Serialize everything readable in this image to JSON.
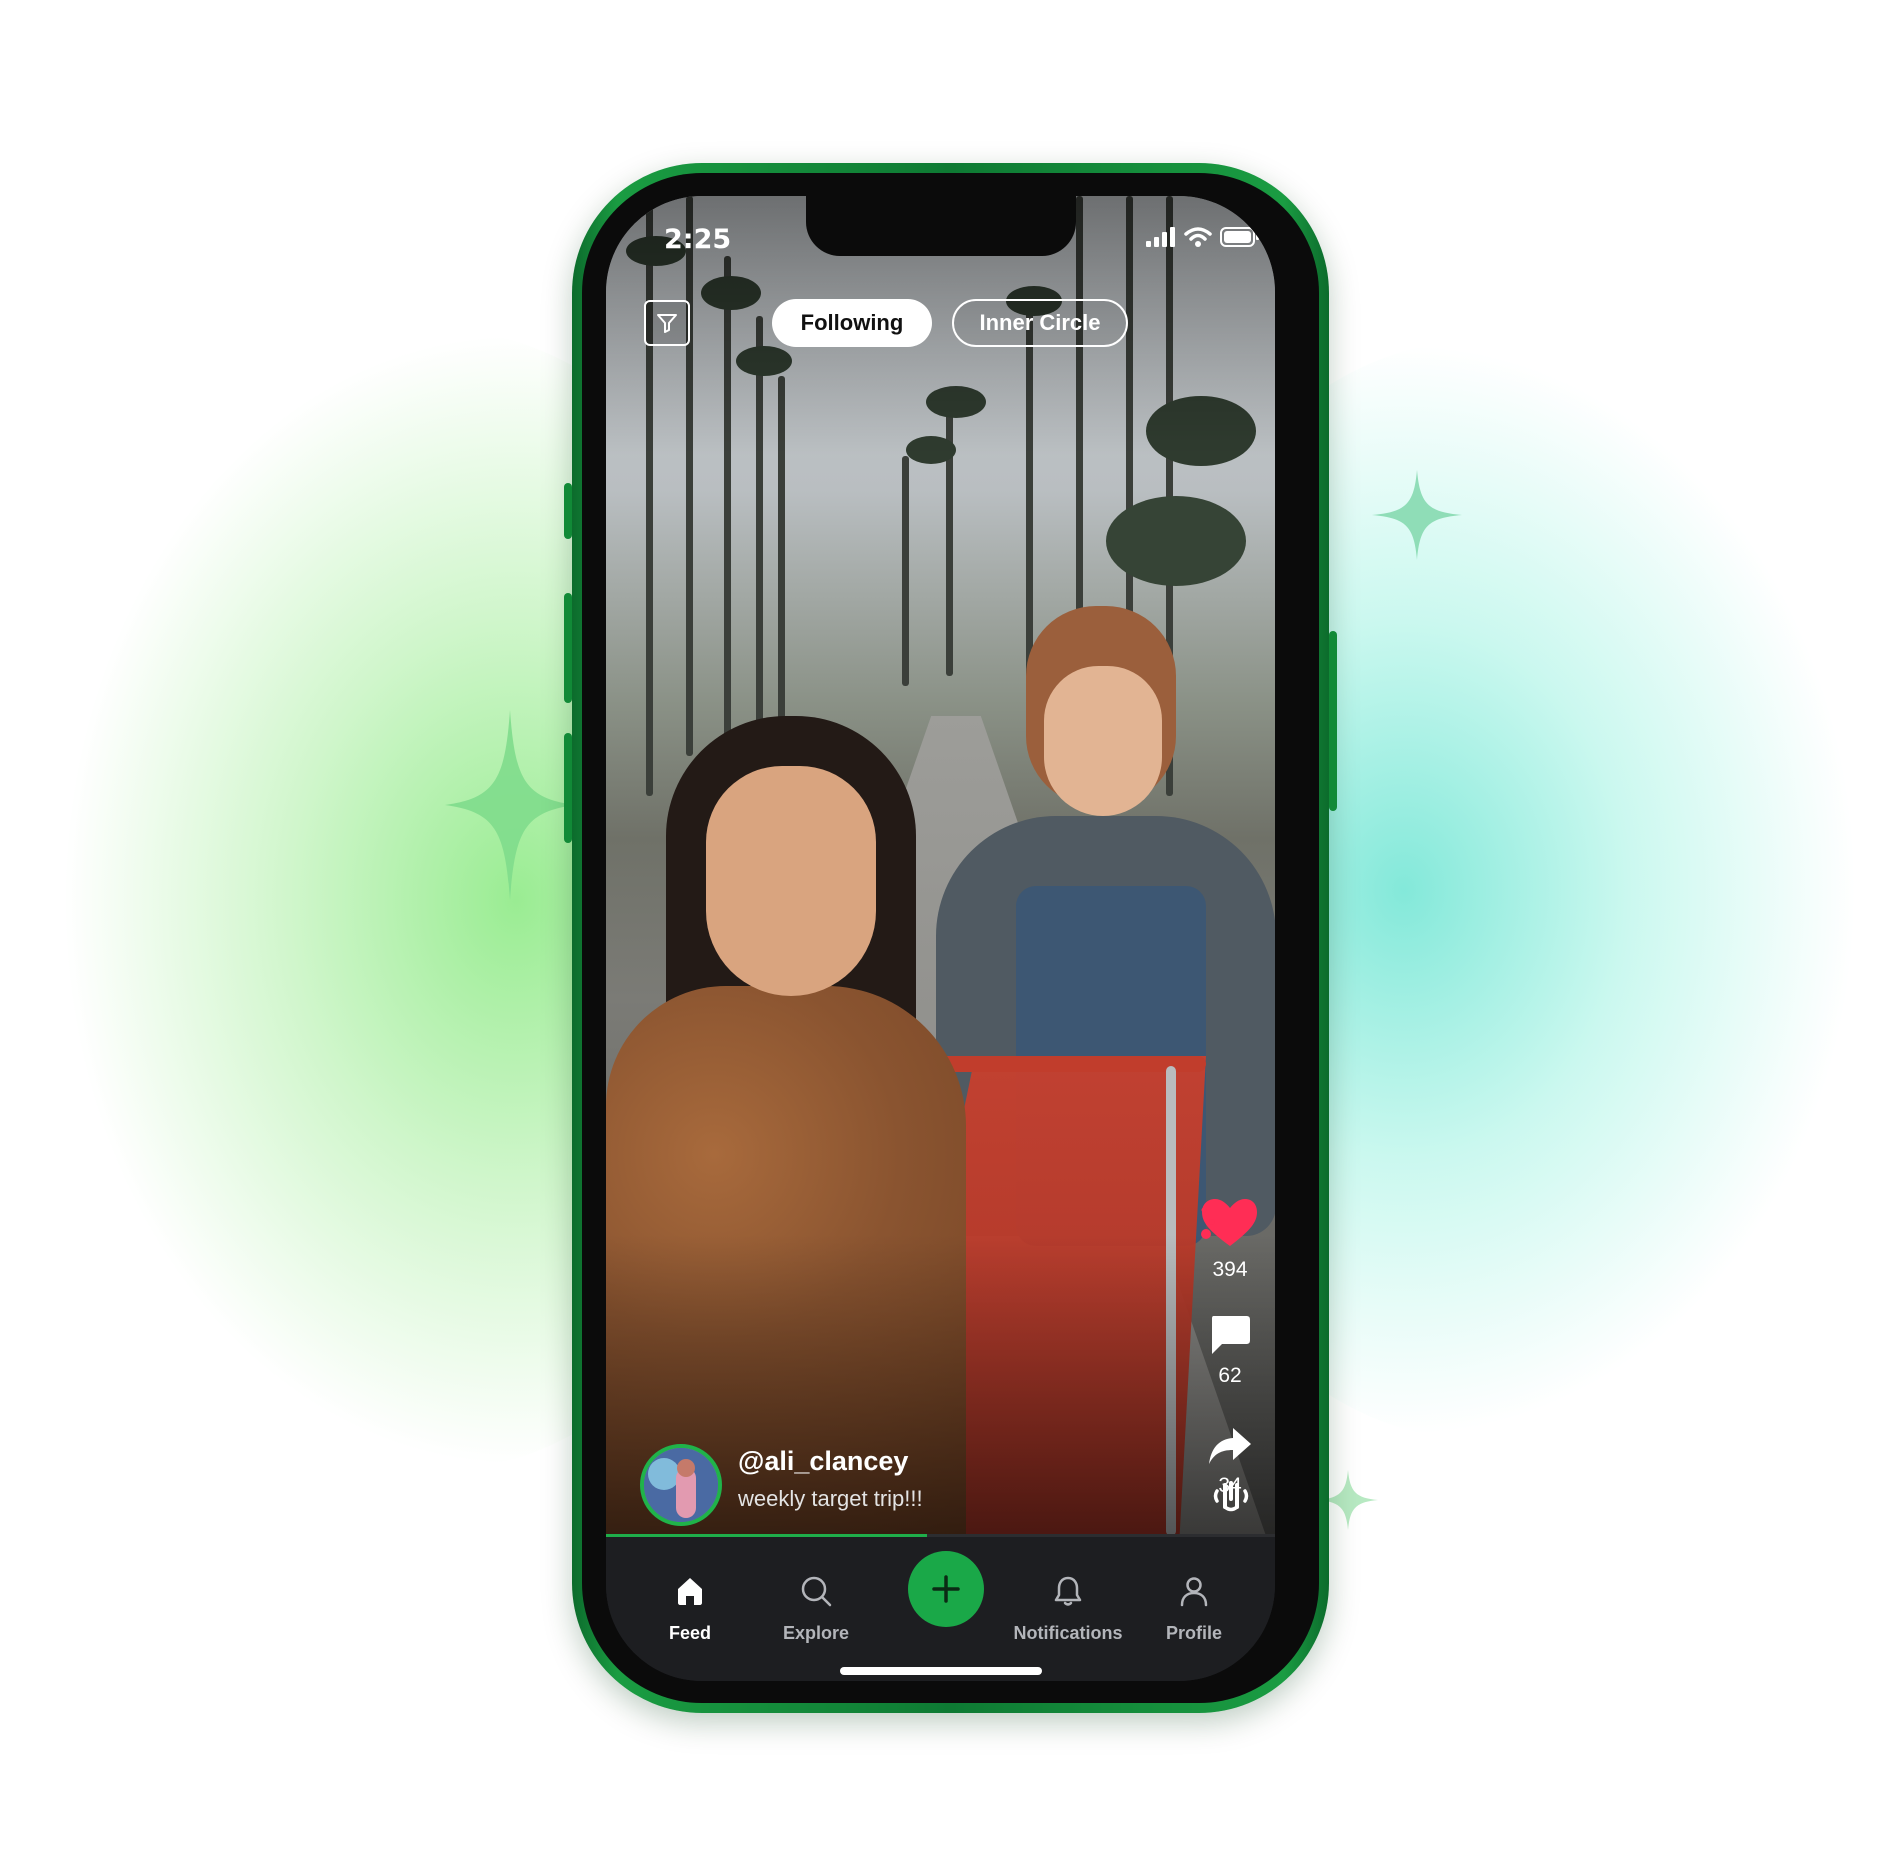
{
  "status_bar": {
    "time": "2:25"
  },
  "tabs": [
    {
      "label": "Following",
      "active": true
    },
    {
      "label": "Inner Circle",
      "active": false
    }
  ],
  "actions": {
    "likes": "394",
    "comments": "62",
    "shares": "34"
  },
  "post": {
    "username": "@ali_clancey",
    "caption": "weekly target trip!!!",
    "progress": 0.48
  },
  "nav": {
    "items": [
      {
        "label": "Feed",
        "icon": "home-icon",
        "active": true
      },
      {
        "label": "Explore",
        "icon": "search-icon",
        "active": false
      },
      {
        "label": "Notifications",
        "icon": "bell-icon",
        "active": false
      },
      {
        "label": "Profile",
        "icon": "user-icon",
        "active": false
      }
    ],
    "create_icon": "plus-icon"
  },
  "colors": {
    "accent": "#1aa848",
    "like": "#ff2d55",
    "frame": "#118a37",
    "nav_bg": "#1d1e21"
  }
}
